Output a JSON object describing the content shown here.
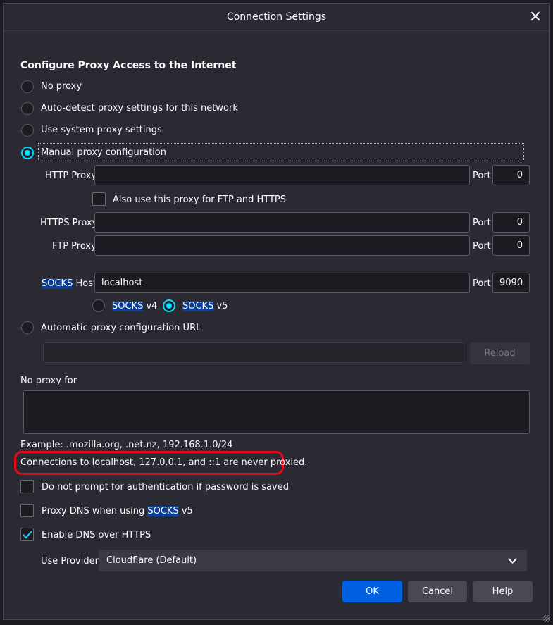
{
  "dialog": {
    "title": "Connection Settings"
  },
  "section_title": "Configure Proxy Access to the Internet",
  "proxy_options": {
    "no_proxy": "No proxy",
    "auto_detect": "Auto-detect proxy settings for this network",
    "system": "Use system proxy settings",
    "manual": "Manual proxy configuration",
    "auto_url": "Automatic proxy configuration URL",
    "selected": "manual"
  },
  "manual": {
    "http_label": "HTTP Proxy",
    "http_value": "",
    "http_port": "0",
    "also_use_label": "Also use this proxy for FTP and HTTPS",
    "also_use_checked": false,
    "https_label": "HTTPS Proxy",
    "https_value": "",
    "https_port": "0",
    "ftp_label": "FTP Proxy",
    "ftp_value": "",
    "ftp_port": "0",
    "socks_label_highlight": "SOCKS",
    "socks_label_rest": " Host",
    "socks_value": "localhost",
    "socks_port": "9090",
    "port_label": "Port",
    "socks_v4_highlight": "SOCKS",
    "socks_v4_rest": " v4",
    "socks_v5_highlight": "SOCKS",
    "socks_v5_rest": " v5",
    "socks_version": "v5"
  },
  "auto_url": {
    "value": "",
    "reload_label": "Reload"
  },
  "no_proxy_for": {
    "label": "No proxy for",
    "value": "",
    "example": "Example: .mozilla.org, .net.nz, 192.168.1.0/24",
    "note": "Connections to localhost, 127.0.0.1, and ::1 are never proxied."
  },
  "options": {
    "no_prompt_label": "Do not prompt for authentication if password is saved",
    "no_prompt_checked": false,
    "proxy_dns_prefix": "Proxy DNS when using ",
    "proxy_dns_highlight": "SOCKS",
    "proxy_dns_suffix": " v5",
    "proxy_dns_checked": false,
    "dns_https_label": "Enable DNS over HTTPS",
    "dns_https_checked": true
  },
  "provider": {
    "label": "Use Provider",
    "selected": "Cloudflare (Default)"
  },
  "buttons": {
    "ok": "OK",
    "cancel": "Cancel",
    "help": "Help"
  },
  "colors": {
    "accent": "#00ddff",
    "primary_button": "#0061e0",
    "annotation": "#e4091b",
    "highlight": "#0a3e94"
  }
}
